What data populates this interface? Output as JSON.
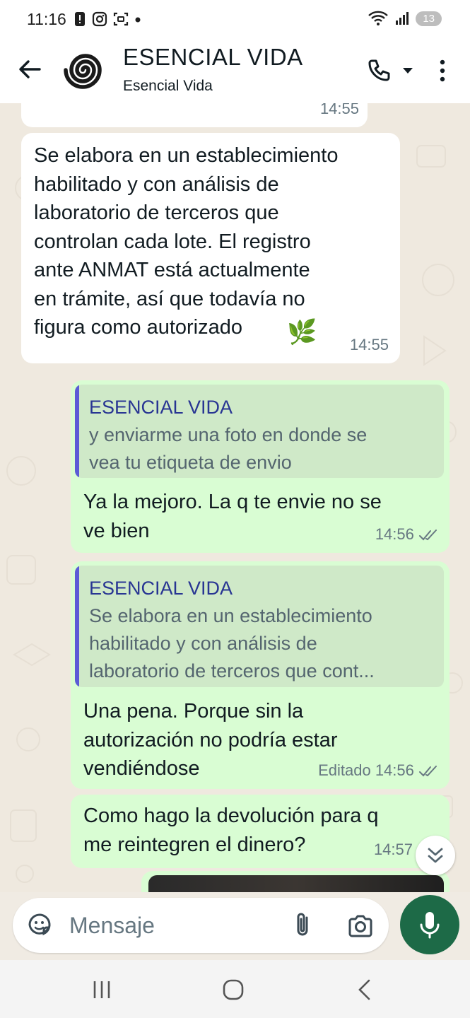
{
  "status_bar": {
    "time": "11:16",
    "battery": "13"
  },
  "header": {
    "contact_name": "ESENCIAL VIDA",
    "contact_subtitle": "Esencial Vida"
  },
  "messages": [
    {
      "direction": "incoming",
      "time": "14:55"
    },
    {
      "direction": "incoming",
      "text": "Se elabora en un establecimiento\nhabilitado y con análisis de\nlaboratorio de terceros que\ncontrolan cada lote. El registro\nante ANMAT está actualmente\nen trámite, así que todavía no\nfigura como autorizado",
      "emoji": "🌿",
      "time": "14:55"
    },
    {
      "direction": "outgoing",
      "quote_author": "ESENCIAL VIDA",
      "quote_text": "y enviarme una foto en donde se\nvea tu etiqueta de envio",
      "text": "Ya la mejoro. La q te envie no se\nve bien",
      "time": "14:56"
    },
    {
      "direction": "outgoing",
      "quote_author": "ESENCIAL VIDA",
      "quote_text": "Se elabora en un establecimiento\nhabilitado y con análisis de\nlaboratorio de terceros que cont...",
      "text": "Una pena. Porque sin la\nautorización no podría estar\nvendiéndose",
      "time": "Editado 14:56"
    },
    {
      "direction": "outgoing",
      "text": "Como hago la devolución para q\nme reintegren el dinero?",
      "time": "14:57"
    }
  ],
  "compose": {
    "placeholder": "Mensaje"
  },
  "colors": {
    "incoming_bubble": "#ffffff",
    "outgoing_bubble": "#d9fdd3",
    "accent_green": "#1d6a47",
    "quote_bar": "#5b5bd6",
    "quote_author": "#283593",
    "read_ticks": "#667781"
  },
  "icons": {
    "back": "arrow-left-icon",
    "call": "phone-icon",
    "menu": "more-vert-icon",
    "emoji": "sticker-icon",
    "attach": "paperclip-icon",
    "camera": "camera-icon",
    "mic": "mic-icon",
    "scroll": "double-chevron-down-icon"
  }
}
